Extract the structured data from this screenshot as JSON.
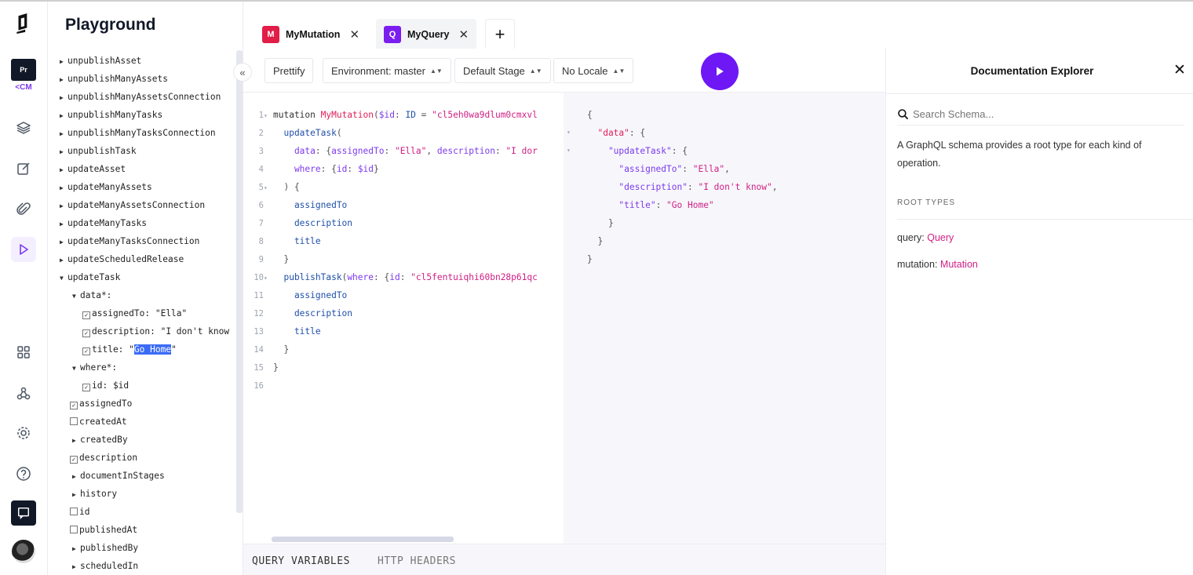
{
  "app": {
    "title": "Playground"
  },
  "rail": {
    "pr_badge": "Pr",
    "cm_tag": "<CM"
  },
  "explorer": {
    "rows": [
      {
        "label": "unpublishAsset"
      },
      {
        "label": "unpublishManyAssets"
      },
      {
        "label": "unpublishManyAssetsConnection"
      },
      {
        "label": "unpublishManyTasks"
      },
      {
        "label": "unpublishManyTasksConnection"
      },
      {
        "label": "unpublishTask"
      },
      {
        "label": "updateAsset"
      },
      {
        "label": "updateManyAssets"
      },
      {
        "label": "updateManyAssetsConnection"
      },
      {
        "label": "updateManyTasks"
      },
      {
        "label": "updateManyTasksConnection"
      },
      {
        "label": "updateScheduledRelease"
      },
      {
        "label": "updateTask"
      },
      {
        "label": "data*:"
      },
      {
        "label": "assignedTo:",
        "value": "\"Ella\""
      },
      {
        "label": "description:",
        "value": "\"I don't know"
      },
      {
        "label": "title:",
        "value_pre": "\"",
        "value_sel": "Go Home",
        "value_post": "\""
      },
      {
        "label": "where*:"
      },
      {
        "label": "id: $id"
      },
      {
        "label": "assignedTo"
      },
      {
        "label": "createdAt"
      },
      {
        "label": "createdBy"
      },
      {
        "label": "description"
      },
      {
        "label": "documentInStages"
      },
      {
        "label": "history"
      },
      {
        "label": "id"
      },
      {
        "label": "publishedAt"
      },
      {
        "label": "publishedBy"
      },
      {
        "label": "scheduledIn"
      }
    ]
  },
  "tabs": [
    {
      "badge": "M",
      "label": "MyMutation",
      "color": "#e11d48"
    },
    {
      "badge": "Q",
      "label": "MyQuery",
      "color": "#7c1df0"
    }
  ],
  "toolbar": {
    "prettify": "Prettify",
    "environment": "Environment: master",
    "stage": "Default Stage",
    "locale": "No Locale"
  },
  "editor": {
    "lines": [
      {
        "n": "1",
        "parts": [
          [
            "kw",
            "mutation "
          ],
          [
            "def",
            "MyMutation"
          ],
          [
            "pun",
            "("
          ],
          [
            "var",
            "$id"
          ],
          [
            "pun",
            ": "
          ],
          [
            "fld",
            "ID"
          ],
          [
            "pun",
            " = "
          ],
          [
            "str",
            "\"cl5eh0wa9dlum0cmxvl"
          ]
        ]
      },
      {
        "n": "2",
        "parts": [
          [
            "fld",
            "  updateTask"
          ],
          [
            "pun",
            "("
          ]
        ]
      },
      {
        "n": "3",
        "parts": [
          [
            "arg",
            "    data"
          ],
          [
            "pun",
            ": {"
          ],
          [
            "arg",
            "assignedTo"
          ],
          [
            "pun",
            ": "
          ],
          [
            "str",
            "\"Ella\""
          ],
          [
            "pun",
            ", "
          ],
          [
            "arg",
            "description"
          ],
          [
            "pun",
            ": "
          ],
          [
            "str",
            "\"I dor"
          ]
        ]
      },
      {
        "n": "4",
        "parts": [
          [
            "arg",
            "    where"
          ],
          [
            "pun",
            ": {"
          ],
          [
            "arg",
            "id"
          ],
          [
            "pun",
            ": "
          ],
          [
            "var",
            "$id"
          ],
          [
            "pun",
            "}"
          ]
        ]
      },
      {
        "n": "5",
        "parts": [
          [
            "pun",
            "  ) {"
          ]
        ]
      },
      {
        "n": "6",
        "parts": [
          [
            "fld",
            "    assignedTo"
          ]
        ]
      },
      {
        "n": "7",
        "parts": [
          [
            "fld",
            "    description"
          ]
        ]
      },
      {
        "n": "8",
        "parts": [
          [
            "fld",
            "    title"
          ]
        ]
      },
      {
        "n": "9",
        "parts": [
          [
            "pun",
            "  }"
          ]
        ]
      },
      {
        "n": "10",
        "parts": [
          [
            "fld",
            "  publishTask"
          ],
          [
            "pun",
            "("
          ],
          [
            "arg",
            "where"
          ],
          [
            "pun",
            ": {"
          ],
          [
            "arg",
            "id"
          ],
          [
            "pun",
            ": "
          ],
          [
            "str",
            "\"cl5fentuiqhi60bn28p61qc"
          ]
        ]
      },
      {
        "n": "11",
        "parts": [
          [
            "fld",
            "    assignedTo"
          ]
        ]
      },
      {
        "n": "12",
        "parts": [
          [
            "fld",
            "    description"
          ]
        ]
      },
      {
        "n": "13",
        "parts": [
          [
            "fld",
            "    title"
          ]
        ]
      },
      {
        "n": "14",
        "parts": [
          [
            "pun",
            "  }"
          ]
        ]
      },
      {
        "n": "15",
        "parts": [
          [
            "pun",
            "}"
          ]
        ]
      },
      {
        "n": "16",
        "parts": []
      }
    ]
  },
  "result": {
    "lines": [
      {
        "parts": [
          [
            "pun",
            "{"
          ]
        ]
      },
      {
        "parts": [
          [
            "rkey",
            "  \"data\""
          ],
          [
            "pun",
            ": {"
          ]
        ]
      },
      {
        "parts": [
          [
            "rkey2",
            "    \"updateTask\""
          ],
          [
            "pun",
            ": {"
          ]
        ]
      },
      {
        "parts": [
          [
            "rkey2",
            "      \"assignedTo\""
          ],
          [
            "pun",
            ": "
          ],
          [
            "rstr",
            "\"Ella\""
          ],
          [
            "pun",
            ","
          ]
        ]
      },
      {
        "parts": [
          [
            "rkey2",
            "      \"description\""
          ],
          [
            "pun",
            ": "
          ],
          [
            "rstr",
            "\"I don't know\""
          ],
          [
            "pun",
            ","
          ]
        ]
      },
      {
        "parts": [
          [
            "rkey2",
            "      \"title\""
          ],
          [
            "pun",
            ": "
          ],
          [
            "rstr",
            "\"Go Home\""
          ]
        ]
      },
      {
        "parts": [
          [
            "pun",
            "    }"
          ]
        ]
      },
      {
        "parts": [
          [
            "pun",
            "  }"
          ]
        ]
      },
      {
        "parts": [
          [
            "pun",
            "}"
          ]
        ]
      }
    ]
  },
  "docs": {
    "title": "Documentation Explorer",
    "search_placeholder": "Search Schema...",
    "description": "A GraphQL schema provides a root type for each kind of operation.",
    "root_types_label": "ROOT TYPES",
    "query_label": "query:",
    "query_type": "Query",
    "mutation_label": "mutation:",
    "mutation_type": "Mutation"
  },
  "bottom": {
    "query_variables": "QUERY VARIABLES",
    "http_headers": "HTTP HEADERS"
  },
  "colors": {
    "accent": "#6d18f5",
    "pink": "#d11e84"
  }
}
